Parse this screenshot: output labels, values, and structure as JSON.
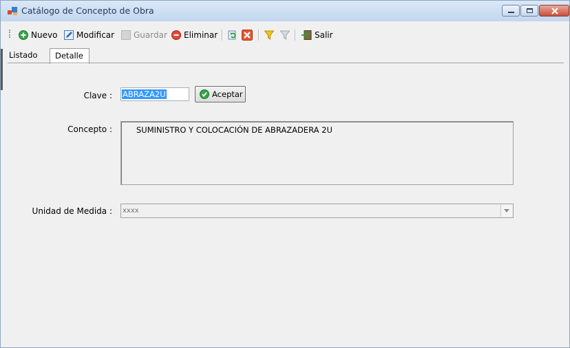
{
  "window": {
    "title": "Catálogo de Concepto de Obra"
  },
  "toolbar": {
    "nuevo": "Nuevo",
    "modificar": "Modificar",
    "guardar": "Guardar",
    "eliminar": "Eliminar",
    "salir": "Salir"
  },
  "tabs": {
    "listado": "Listado",
    "detalle": "Detalle"
  },
  "form": {
    "clave_label": "Clave :",
    "clave_value": "ABRAZA2U",
    "aceptar_label": "Aceptar",
    "concepto_label": "Concepto :",
    "concepto_value": "SUMINISTRO Y COLOCACIÓN DE ABRAZADERA 2U",
    "unidad_label": "Unidad de Medida :",
    "unidad_value": "xxxx"
  },
  "icons": [
    "app-icon",
    "add-icon",
    "edit-icon",
    "save-icon",
    "delete-icon",
    "refresh-icon",
    "cancel-icon",
    "filter-icon",
    "clear-filter-icon",
    "exit-icon",
    "check-icon"
  ],
  "colors": {
    "titlebar": "#c2d6ee",
    "selection": "#3399ff",
    "close_button": "#c7503c"
  }
}
